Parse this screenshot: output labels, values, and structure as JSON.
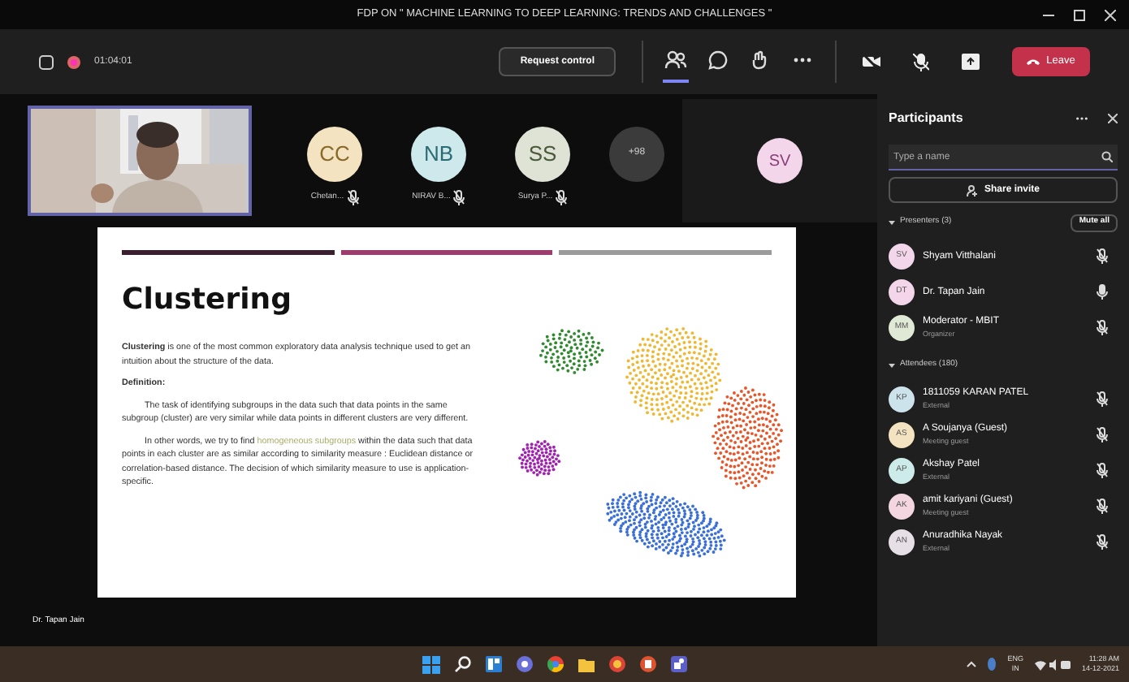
{
  "window": {
    "title": "FDP ON \" MACHINE LEARNING TO DEEP LEARNING: TRENDS AND CHALLENGES \""
  },
  "meeting": {
    "timer": "01:04:01",
    "request_control": "Request control",
    "leave": "Leave"
  },
  "toolbar": [
    {
      "kind": "people",
      "selected": true
    },
    {
      "kind": "chat",
      "selected": false
    },
    {
      "kind": "react",
      "selected": false
    },
    {
      "kind": "more",
      "selected": false
    }
  ],
  "stage": {
    "video_name": "Dr. Tapan Jain",
    "avatars": [
      {
        "initials": "CC",
        "name": "Chetan...",
        "color": "#f3e3c0"
      },
      {
        "initials": "NB",
        "name": "NIRAV B...",
        "color": "#cde9ec"
      },
      {
        "initials": "SS",
        "name": "Surya P...",
        "color": "#dfe3d6"
      }
    ],
    "overflow": "+98",
    "spotlight_initials": "SV"
  },
  "slide": {
    "title": "Clustering",
    "paragraphs": [
      {
        "kind": "body",
        "text": "**Clustering** is one of the most common exploratory data analysis technique used to get an intuition about the structure of the data."
      },
      {
        "kind": "heading",
        "text": "Definition:"
      },
      {
        "kind": "indented",
        "text": "The task of identifying subgroups in the data such that data points in the same subgroup (cluster) are very similar while data points in different clusters are very different."
      },
      {
        "kind": "indented",
        "text": "In other words, we try to find *homogeneous subgroups* within the data such that data points in each cluster are as similar according to similarity measure : Euclidean distance or correlation-based distance. The decision of which similarity measure to use is application-specific."
      }
    ]
  },
  "participants": {
    "title": "Participants",
    "search_placeholder": "Type a name",
    "share_invite": "Share invite",
    "presenters_label": "Presenters (3)",
    "mute_all": "Mute all",
    "attendees_label": "Attendees (180)",
    "presenters": [
      {
        "initials": "SV",
        "name": "Shyam Vitthalani",
        "color": "#f3d6ea",
        "muted": true
      },
      {
        "initials": "DT",
        "name": "Dr. Tapan Jain",
        "color": "#f3d6ea",
        "muted": false
      },
      {
        "initials": "MM",
        "name": "Moderator - MBIT",
        "role": "Organizer",
        "color": "#dfe9d6",
        "muted": true
      }
    ],
    "attendees": [
      {
        "initials": "KP",
        "name": "1811059 KARAN PATEL",
        "role": "External",
        "color": "#cde3ec",
        "muted": true
      },
      {
        "initials": "AS",
        "name": "A Soujanya (Guest)",
        "role": "Meeting guest",
        "color": "#f3e3c0",
        "muted": true
      },
      {
        "initials": "AP",
        "name": "Akshay Patel",
        "role": "External",
        "color": "#cdece9",
        "muted": true
      },
      {
        "initials": "AK",
        "name": "amit kariyani (Guest)",
        "role": "Meeting guest",
        "color": "#f3d6e0",
        "muted": true
      },
      {
        "initials": "AN",
        "name": "Anuradhika Nayak",
        "role": "External",
        "color": "#e6e0e6",
        "muted": true
      }
    ]
  },
  "taskbar": {
    "lang_top": "ENG",
    "lang_bottom": "IN",
    "time": "11:28 AM",
    "date": "14-12-2021"
  }
}
